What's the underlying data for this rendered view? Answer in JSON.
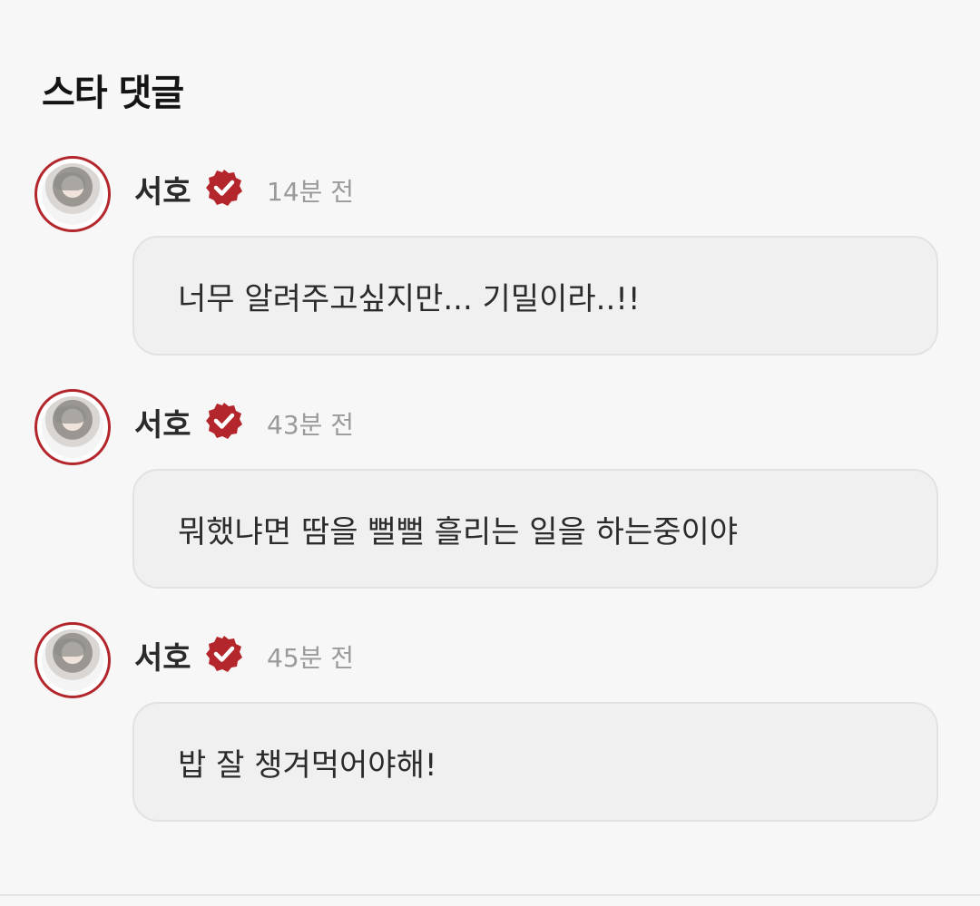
{
  "section": {
    "title": "스타 댓글"
  },
  "colors": {
    "accent": "#b3262b",
    "bubble_bg": "#f0f0f0",
    "time": "#9a9a9a"
  },
  "comments": [
    {
      "author": "서호",
      "time": "14분 전",
      "text": "너무 알려주고싶지만... 기밀이라..!!",
      "badge_icon": "verified-icon",
      "avatar_icon": "avatar"
    },
    {
      "author": "서호",
      "time": "43분 전",
      "text": "뭐했냐면 땀을 뻘뻘 흘리는 일을 하는중이야",
      "badge_icon": "verified-icon",
      "avatar_icon": "avatar"
    },
    {
      "author": "서호",
      "time": "45분 전",
      "text": "밥 잘 챙겨먹어야해!",
      "badge_icon": "verified-icon",
      "avatar_icon": "avatar"
    }
  ]
}
